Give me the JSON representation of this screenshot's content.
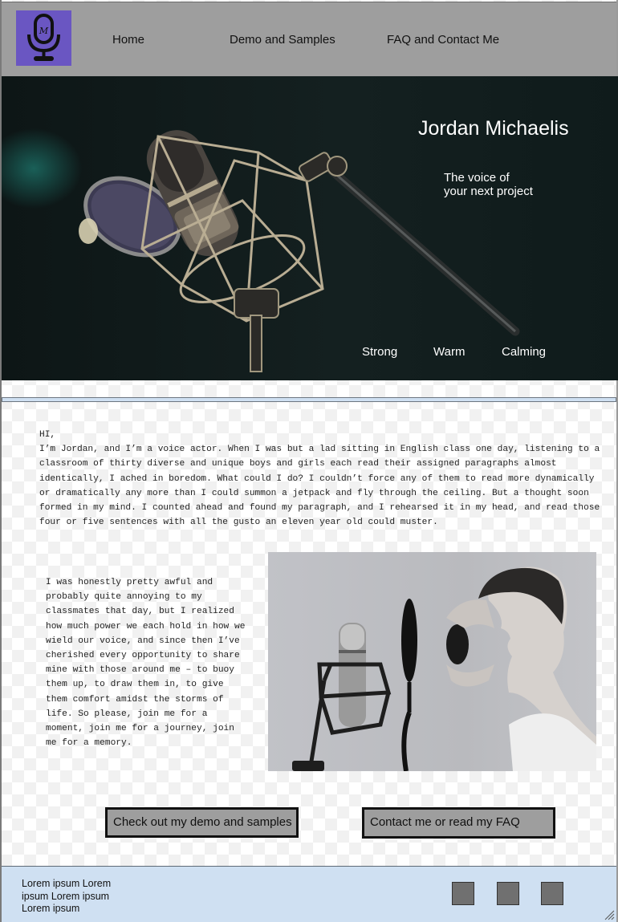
{
  "nav": {
    "logo_icon": "microphone-logo-icon",
    "links": [
      "Home",
      "Demo and Samples",
      "FAQ and Contact Me"
    ]
  },
  "hero": {
    "title": "Jordan Michaelis",
    "subtitle_line1": "The voice of",
    "subtitle_line2": "your next project",
    "traits": [
      "Strong",
      "Warm",
      "Calming"
    ]
  },
  "intro": {
    "greeting": "HI,",
    "paragraph": "I’m Jordan, and I’m a voice actor.  When I was but a lad sitting in English class one day, listening to a classroom of thirty diverse and unique boys and girls each read their assigned paragraphs almost identically, I ached in boredom.  What could I do?  I couldn’t force any of them to read more dynamically or dramatically any more than I could summon a jetpack and fly through the ceiling.  But a thought soon formed in my mind.  I counted ahead and found my paragraph, and I rehearsed it in my head, and read those four or five sentences with all the gusto an eleven year old could muster."
  },
  "story": "I was honestly pretty awful and probably quite annoying to my classmates that day, but I realized how much power we each hold in how we wield our voice, and since then I’ve cherished every opportunity to share mine with those around me – to buoy them up, to draw them in, to give them comfort amidst the storms of life.  So please, join me for a moment, join me for a journey, join me for a memory.",
  "buttons": {
    "demo": "Check out my demo and samples",
    "contact": "Contact me or read my FAQ"
  },
  "footer": {
    "text": "Lorem ipsum Lorem ipsum Lorem ipsum Lorem ipsum",
    "social_icons": [
      "social-icon-1",
      "social-icon-2",
      "social-icon-3"
    ]
  },
  "colors": {
    "header_bg": "#9e9e9e",
    "logo_bg": "#6a56c2",
    "hero_bg": "#142020",
    "footer_bg": "#cfe0f2",
    "button_bg": "#9e9e9e",
    "social_icon": "#707070"
  }
}
